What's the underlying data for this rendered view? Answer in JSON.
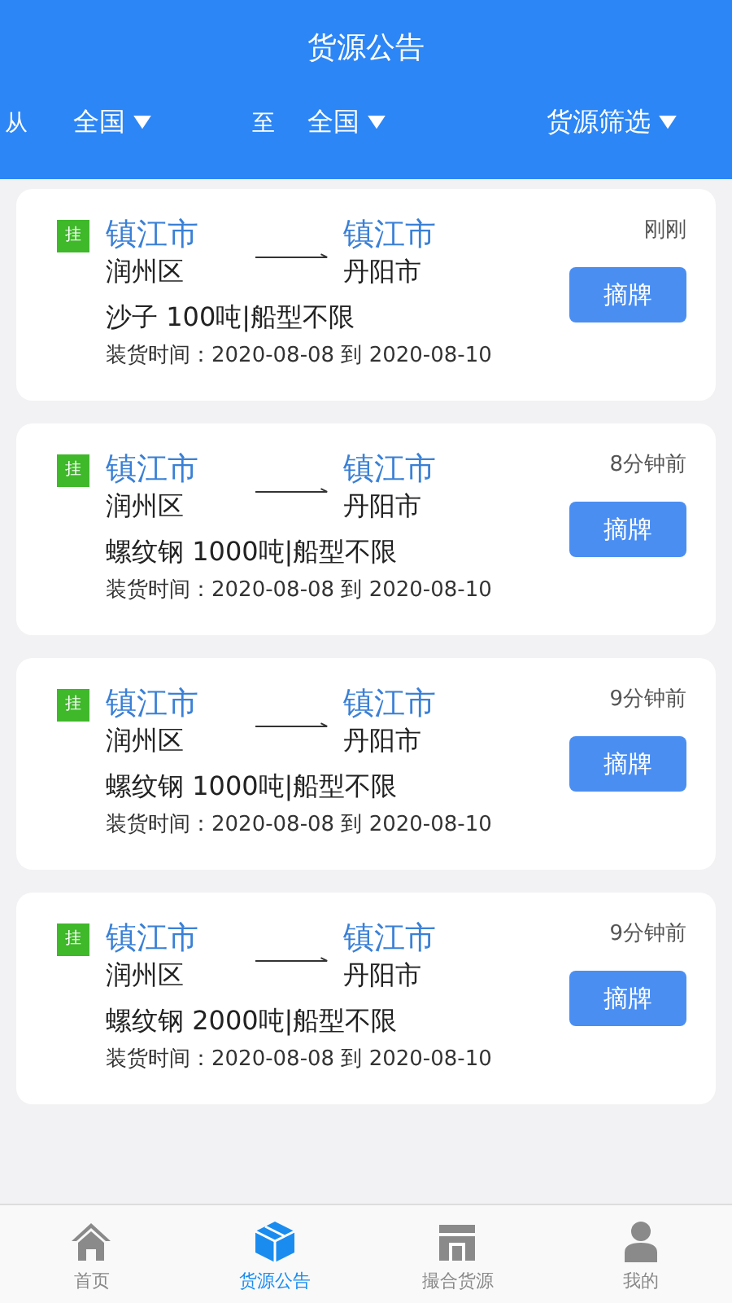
{
  "header": {
    "title": "货源公告"
  },
  "filters": {
    "from_label": "从",
    "from_value": "全国",
    "to_label": "至",
    "to_value": "全国",
    "filter_label": "货源筛选"
  },
  "listings": [
    {
      "badge": "挂",
      "from_city": "镇江市",
      "from_district": "润州区",
      "to_city": "镇江市",
      "to_district": "丹阳市",
      "cargo": "沙子 100吨|船型不限",
      "load_time": "装货时间：2020-08-08 到 2020-08-10",
      "posted": "刚刚",
      "action": "摘牌"
    },
    {
      "badge": "挂",
      "from_city": "镇江市",
      "from_district": "润州区",
      "to_city": "镇江市",
      "to_district": "丹阳市",
      "cargo": "螺纹钢 1000吨|船型不限",
      "load_time": "装货时间：2020-08-08 到 2020-08-10",
      "posted": "8分钟前",
      "action": "摘牌"
    },
    {
      "badge": "挂",
      "from_city": "镇江市",
      "from_district": "润州区",
      "to_city": "镇江市",
      "to_district": "丹阳市",
      "cargo": "螺纹钢 1000吨|船型不限",
      "load_time": "装货时间：2020-08-08 到 2020-08-10",
      "posted": "9分钟前",
      "action": "摘牌"
    },
    {
      "badge": "挂",
      "from_city": "镇江市",
      "from_district": "润州区",
      "to_city": "镇江市",
      "to_district": "丹阳市",
      "cargo": "螺纹钢 2000吨|船型不限",
      "load_time": "装货时间：2020-08-08 到 2020-08-10",
      "posted": "9分钟前",
      "action": "摘牌"
    }
  ],
  "tab_bar": [
    {
      "label": "首页",
      "selected": false
    },
    {
      "label": "货源公告",
      "selected": true
    },
    {
      "label": "撮合货源",
      "selected": false
    },
    {
      "label": "我的",
      "selected": false
    }
  ]
}
